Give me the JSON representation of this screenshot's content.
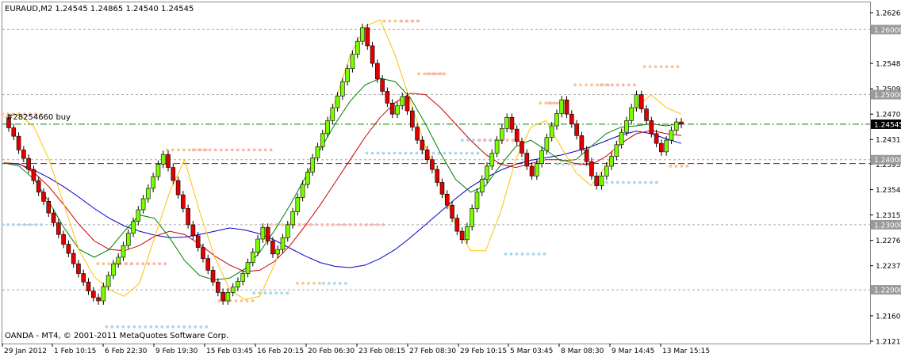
{
  "chart_data": {
    "type": "candlestick",
    "symbol_info": "EURAUD,M2  1.24545 1.24865 1.24540 1.24545",
    "order_label": "#28254660 buy",
    "footer": "OANDA - MT4, © 2001-2011 MetaQuotes Software Corp.",
    "ylim": [
      1.2121,
      1.2626
    ],
    "y_ticks": [
      "1.26260",
      "1.25480",
      "1.25090",
      "1.24700",
      "1.24310",
      "1.23930",
      "1.23540",
      "1.23150",
      "1.22760",
      "1.22370",
      "1.21600",
      "1.21210"
    ],
    "y_ticks_values": [
      1.2626,
      1.2548,
      1.2509,
      1.247,
      1.2431,
      1.2393,
      1.2354,
      1.2315,
      1.2276,
      1.2237,
      1.216,
      1.2121
    ],
    "level_labels": [
      {
        "value": 1.26,
        "label": "1.26000"
      },
      {
        "value": 1.25,
        "label": "1.25000"
      },
      {
        "value": 1.24,
        "label": "1.24000"
      },
      {
        "value": 1.23,
        "label": "1.23000"
      },
      {
        "value": 1.22,
        "label": "1.22000"
      }
    ],
    "current_price": {
      "value": 1.24545,
      "label": "1.24545"
    },
    "order_price": 1.24545,
    "red_line": 1.2394,
    "x_labels": [
      "29 Jan 2012",
      "1 Feb 10:15",
      "6 Feb 22:30",
      "9 Feb 19:30",
      "15 Feb 03:45",
      "16 Feb 20:15",
      "20 Feb 06:30",
      "23 Feb 08:15",
      "27 Feb 08:30",
      "29 Feb 10:15",
      "5 Mar 03:45",
      "8 Mar 08:30",
      "9 Mar 14:45",
      "13 Mar 15:15"
    ],
    "candle_closes": [
      1.2449,
      1.2436,
      1.2415,
      1.2402,
      1.2385,
      1.2368,
      1.235,
      1.2336,
      1.2318,
      1.2303,
      1.2285,
      1.227,
      1.2256,
      1.224,
      1.2225,
      1.2212,
      1.2198,
      1.2188,
      1.2183,
      1.2205,
      1.2222,
      1.224,
      1.225,
      1.2268,
      1.2287,
      1.2305,
      1.2323,
      1.234,
      1.2356,
      1.2374,
      1.2393,
      1.2408,
      1.2388,
      1.2368,
      1.2346,
      1.2325,
      1.23,
      1.2283,
      1.2265,
      1.2248,
      1.223,
      1.2212,
      1.2196,
      1.2183,
      1.2196,
      1.2204,
      1.2213,
      1.2225,
      1.2242,
      1.2258,
      1.2278,
      1.2296,
      1.2275,
      1.2255,
      1.2262,
      1.228,
      1.23,
      1.232,
      1.2342,
      1.2362,
      1.2381,
      1.2403,
      1.242,
      1.244,
      1.246,
      1.248,
      1.2498,
      1.252,
      1.254,
      1.2562,
      1.2582,
      1.2603,
      1.2575,
      1.2548,
      1.2524,
      1.2505,
      1.2487,
      1.247,
      1.2483,
      1.2497,
      1.2475,
      1.245,
      1.243,
      1.2415,
      1.24,
      1.2385,
      1.2365,
      1.2347,
      1.233,
      1.231,
      1.229,
      1.2277,
      1.2297,
      1.2325,
      1.235,
      1.237,
      1.239,
      1.241,
      1.243,
      1.2448,
      1.2465,
      1.2447,
      1.2428,
      1.241,
      1.239,
      1.2375,
      1.2394,
      1.2414,
      1.2434,
      1.2452,
      1.2471,
      1.2492,
      1.247,
      1.2455,
      1.2437,
      1.2415,
      1.2397,
      1.2375,
      1.236,
      1.2375,
      1.239,
      1.2405,
      1.2423,
      1.2442,
      1.246,
      1.248,
      1.25,
      1.2478,
      1.246,
      1.244,
      1.2425,
      1.2412,
      1.243,
      1.2445,
      1.2458,
      1.24545
    ],
    "indicator_series": [
      {
        "color": "#0000cc",
        "values": [
          1.2395,
          1.2393,
          1.2384,
          1.2372,
          1.2358,
          1.2342,
          1.2325,
          1.231,
          1.2298,
          1.229,
          1.2284,
          1.228,
          1.2281,
          1.2285,
          1.229,
          1.2295,
          1.2292,
          1.2286,
          1.2276,
          1.2264,
          1.2252,
          1.2242,
          1.2236,
          1.2234,
          1.2238,
          1.2248,
          1.2262,
          1.228,
          1.23,
          1.232,
          1.234,
          1.2358,
          1.2372,
          1.2384,
          1.2393,
          1.2399,
          1.2403,
          1.2407,
          1.2413,
          1.242,
          1.2429,
          1.2438,
          1.2444,
          1.244,
          1.2432,
          1.2425
        ]
      },
      {
        "color": "#cc0000",
        "values": [
          1.2395,
          1.2394,
          1.238,
          1.2358,
          1.233,
          1.23,
          1.2275,
          1.2262,
          1.226,
          1.2268,
          1.2282,
          1.229,
          1.2285,
          1.227,
          1.2252,
          1.2238,
          1.2228,
          1.223,
          1.2244,
          1.2268,
          1.2298,
          1.233,
          1.2365,
          1.24,
          1.2435,
          1.2465,
          1.2488,
          1.2502,
          1.25,
          1.248,
          1.2455,
          1.243,
          1.2408,
          1.2393,
          1.2388,
          1.2394,
          1.24,
          1.24,
          1.2394,
          1.2392,
          1.2405,
          1.2425,
          1.244,
          1.2445,
          1.244,
          1.2437
        ]
      },
      {
        "color": "#008000",
        "values": [
          1.2395,
          1.239,
          1.237,
          1.2335,
          1.2295,
          1.2262,
          1.225,
          1.2262,
          1.229,
          1.2315,
          1.231,
          1.228,
          1.2245,
          1.2222,
          1.2215,
          1.2218,
          1.2232,
          1.2258,
          1.2292,
          1.233,
          1.2372,
          1.2415,
          1.2455,
          1.249,
          1.2515,
          1.2525,
          1.252,
          1.2495,
          1.2455,
          1.241,
          1.237,
          1.235,
          1.236,
          1.2392,
          1.242,
          1.243,
          1.2415,
          1.2398,
          1.24,
          1.242,
          1.244,
          1.245,
          1.2452,
          1.2455,
          1.2452,
          1.2456
        ]
      },
      {
        "color": "#ffc000",
        "values": [
          1.2465,
          1.247,
          1.245,
          1.24,
          1.233,
          1.226,
          1.222,
          1.22,
          1.219,
          1.221,
          1.228,
          1.235,
          1.24,
          1.232,
          1.225,
          1.22,
          1.2185,
          1.219,
          1.224,
          1.23,
          1.236,
          1.242,
          1.249,
          1.256,
          1.2605,
          1.2615,
          1.256,
          1.249,
          1.242,
          1.236,
          1.23,
          1.226,
          1.226,
          1.232,
          1.24,
          1.245,
          1.246,
          1.242,
          1.238,
          1.236,
          1.239,
          1.244,
          1.248,
          1.25,
          1.248,
          1.247
        ]
      }
    ],
    "dot_levels": [
      {
        "color": "#f7c690",
        "y": 1.247,
        "from": 0.0,
        "to": 0.05
      },
      {
        "color": "#ffb0b0",
        "y": 1.247,
        "from": 0.0,
        "to": 0.04
      },
      {
        "color": "#a8d8ea",
        "y": 1.23,
        "from": 0.0,
        "to": 0.05
      },
      {
        "color": "#f7c690",
        "y": 1.224,
        "from": 0.11,
        "to": 0.15
      },
      {
        "color": "#ffb0b0",
        "y": 1.224,
        "from": 0.13,
        "to": 0.19
      },
      {
        "color": "#a8d8ea",
        "y": 1.2143,
        "from": 0.12,
        "to": 0.24
      },
      {
        "color": "#f7c690",
        "y": 1.2415,
        "from": 0.19,
        "to": 0.24
      },
      {
        "color": "#ffb0b0",
        "y": 1.2415,
        "from": 0.22,
        "to": 0.31
      },
      {
        "color": "#f7c690",
        "y": 1.2183,
        "from": 0.25,
        "to": 0.29
      },
      {
        "color": "#a8d8ea",
        "y": 1.2195,
        "from": 0.29,
        "to": 0.33
      },
      {
        "color": "#f7c690",
        "y": 1.23,
        "from": 0.31,
        "to": 0.36
      },
      {
        "color": "#ffb0b0",
        "y": 1.23,
        "from": 0.33,
        "to": 0.44
      },
      {
        "color": "#f7c690",
        "y": 1.221,
        "from": 0.34,
        "to": 0.37
      },
      {
        "color": "#a8d8ea",
        "y": 1.221,
        "from": 0.37,
        "to": 0.4
      },
      {
        "color": "#f7c690",
        "y": 1.2613,
        "from": 0.44,
        "to": 0.48
      },
      {
        "color": "#ffb0b0",
        "y": 1.2613,
        "from": 0.46,
        "to": 0.48
      },
      {
        "color": "#a8d8ea",
        "y": 1.241,
        "from": 0.42,
        "to": 0.55
      },
      {
        "color": "#f7c690",
        "y": 1.2532,
        "from": 0.48,
        "to": 0.51
      },
      {
        "color": "#ffb0b0",
        "y": 1.2532,
        "from": 0.49,
        "to": 0.51
      },
      {
        "color": "#a8d8ea",
        "y": 1.243,
        "from": 0.53,
        "to": 0.58
      },
      {
        "color": "#ffb0b0",
        "y": 1.243,
        "from": 0.55,
        "to": 0.6
      },
      {
        "color": "#a8d8ea",
        "y": 1.2255,
        "from": 0.58,
        "to": 0.63
      },
      {
        "color": "#f7c690",
        "y": 1.2487,
        "from": 0.62,
        "to": 0.65
      },
      {
        "color": "#ffb0b0",
        "y": 1.2487,
        "from": 0.63,
        "to": 0.65
      },
      {
        "color": "#a8d8ea",
        "y": 1.2393,
        "from": 0.64,
        "to": 0.68
      },
      {
        "color": "#f7c690",
        "y": 1.2515,
        "from": 0.66,
        "to": 0.7
      },
      {
        "color": "#ffb0b0",
        "y": 1.2515,
        "from": 0.69,
        "to": 0.73
      },
      {
        "color": "#a8d8ea",
        "y": 1.2365,
        "from": 0.69,
        "to": 0.76
      },
      {
        "color": "#f7c690",
        "y": 1.2543,
        "from": 0.74,
        "to": 0.78
      },
      {
        "color": "#f7c690",
        "y": 1.239,
        "from": 0.77,
        "to": 0.79
      }
    ]
  }
}
